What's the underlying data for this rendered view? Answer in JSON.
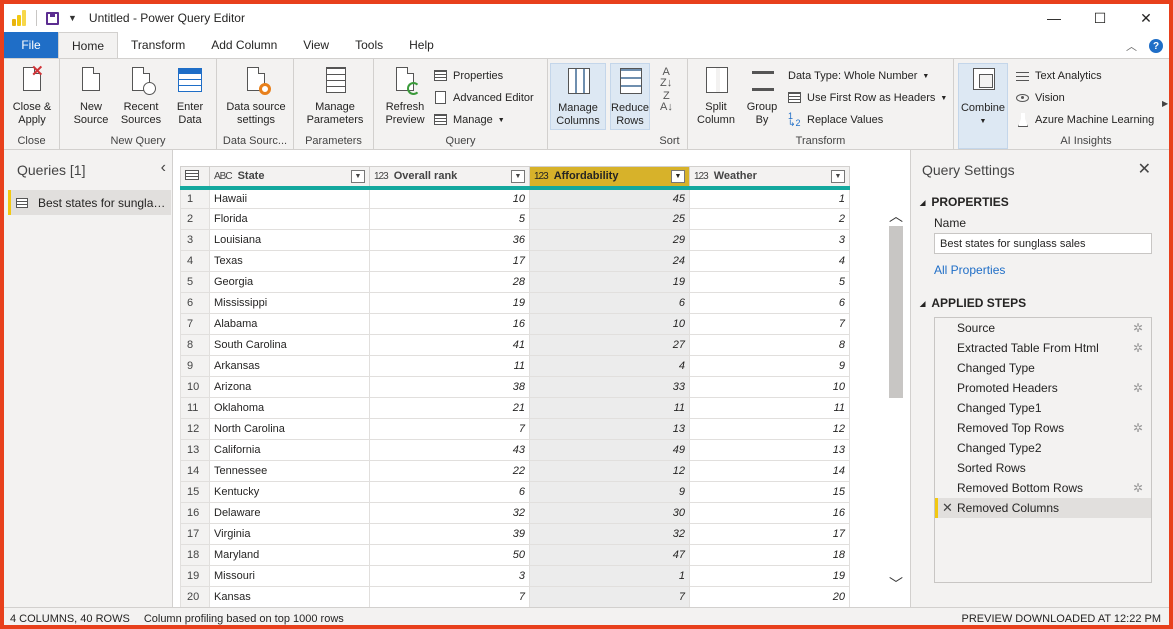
{
  "window": {
    "title": "Untitled - Power Query Editor",
    "minimize": "—",
    "maximize": "☐",
    "close": "✕"
  },
  "tabs": [
    "File",
    "Home",
    "Transform",
    "Add Column",
    "View",
    "Tools",
    "Help"
  ],
  "ribbon": {
    "close_apply": "Close &\nApply",
    "close_group": "Close",
    "new_source": "New\nSource",
    "recent_sources": "Recent\nSources",
    "enter_data": "Enter\nData",
    "new_query_group": "New Query",
    "data_source_settings": "Data source\nsettings",
    "data_sources_group": "Data Sourc...",
    "manage_parameters": "Manage\nParameters",
    "parameters_group": "Parameters",
    "refresh_preview": "Refresh\nPreview",
    "properties": "Properties",
    "advanced_editor": "Advanced Editor",
    "manage": "Manage",
    "query_group": "Query",
    "manage_columns": "Manage\nColumns",
    "reduce_rows": "Reduce\nRows",
    "sort_group": "Sort",
    "split_column": "Split\nColumn",
    "group_by": "Group\nBy",
    "data_type": "Data Type: Whole Number",
    "first_row_headers": "Use First Row as Headers",
    "replace_values": "Replace Values",
    "transform_group": "Transform",
    "combine": "Combine",
    "text_analytics": "Text Analytics",
    "vision": "Vision",
    "azure_ml": "Azure Machine Learning",
    "ai_group": "AI Insights"
  },
  "queries": {
    "title": "Queries [1]",
    "items": [
      "Best states for sunglass sales"
    ]
  },
  "grid": {
    "columns": [
      {
        "type": "ABC",
        "name": "State"
      },
      {
        "type": "123",
        "name": "Overall rank"
      },
      {
        "type": "123",
        "name": "Affordability"
      },
      {
        "type": "123",
        "name": "Weather"
      }
    ],
    "rows": [
      [
        "1",
        "Hawaii",
        "10",
        "45",
        "1"
      ],
      [
        "2",
        "Florida",
        "5",
        "25",
        "2"
      ],
      [
        "3",
        "Louisiana",
        "36",
        "29",
        "3"
      ],
      [
        "4",
        "Texas",
        "17",
        "24",
        "4"
      ],
      [
        "5",
        "Georgia",
        "28",
        "19",
        "5"
      ],
      [
        "6",
        "Mississippi",
        "19",
        "6",
        "6"
      ],
      [
        "7",
        "Alabama",
        "16",
        "10",
        "7"
      ],
      [
        "8",
        "South Carolina",
        "41",
        "27",
        "8"
      ],
      [
        "9",
        "Arkansas",
        "11",
        "4",
        "9"
      ],
      [
        "10",
        "Arizona",
        "38",
        "33",
        "10"
      ],
      [
        "11",
        "Oklahoma",
        "21",
        "11",
        "11"
      ],
      [
        "12",
        "North Carolina",
        "7",
        "13",
        "12"
      ],
      [
        "13",
        "California",
        "43",
        "49",
        "13"
      ],
      [
        "14",
        "Tennessee",
        "22",
        "12",
        "14"
      ],
      [
        "15",
        "Kentucky",
        "6",
        "9",
        "15"
      ],
      [
        "16",
        "Delaware",
        "32",
        "30",
        "16"
      ],
      [
        "17",
        "Virginia",
        "39",
        "32",
        "17"
      ],
      [
        "18",
        "Maryland",
        "50",
        "47",
        "18"
      ],
      [
        "19",
        "Missouri",
        "3",
        "1",
        "19"
      ],
      [
        "20",
        "Kansas",
        "7",
        "7",
        "20"
      ]
    ]
  },
  "settings": {
    "title": "Query Settings",
    "properties_head": "PROPERTIES",
    "name_label": "Name",
    "name_value": "Best states for sunglass sales",
    "all_properties": "All Properties",
    "steps_head": "APPLIED STEPS",
    "steps": [
      {
        "name": "Source",
        "gear": true
      },
      {
        "name": "Extracted Table From Html",
        "gear": true
      },
      {
        "name": "Changed Type",
        "gear": false
      },
      {
        "name": "Promoted Headers",
        "gear": true
      },
      {
        "name": "Changed Type1",
        "gear": false
      },
      {
        "name": "Removed Top Rows",
        "gear": true
      },
      {
        "name": "Changed Type2",
        "gear": false
      },
      {
        "name": "Sorted Rows",
        "gear": false
      },
      {
        "name": "Removed Bottom Rows",
        "gear": true
      },
      {
        "name": "Removed Columns",
        "gear": false,
        "active": true
      }
    ]
  },
  "status": {
    "columns_rows": "4 COLUMNS, 40 ROWS",
    "profiling": "Column profiling based on top 1000 rows",
    "preview": "PREVIEW DOWNLOADED AT 12:22 PM"
  }
}
